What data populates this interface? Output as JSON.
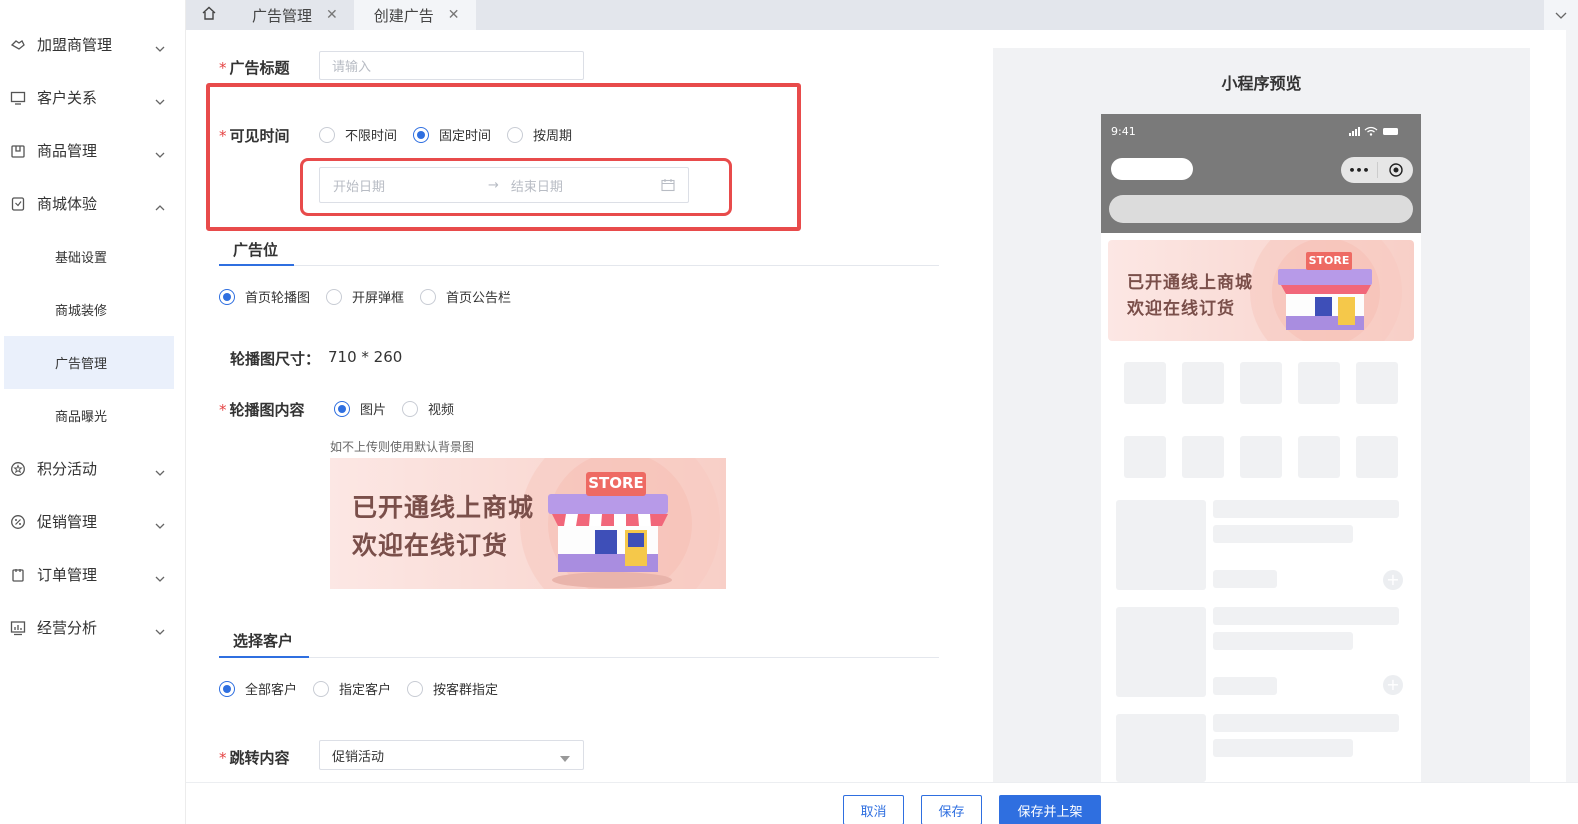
{
  "sidebar": {
    "items": [
      {
        "label": "加盟商管理",
        "icon": "handshake-icon",
        "expanded": false
      },
      {
        "label": "客户关系",
        "icon": "monitor-icon",
        "expanded": false
      },
      {
        "label": "商品管理",
        "icon": "box-icon",
        "expanded": false
      },
      {
        "label": "商城体验",
        "icon": "clipboard-icon",
        "expanded": true
      },
      {
        "label": "积分活动",
        "icon": "star-badge-icon",
        "expanded": false
      },
      {
        "label": "促销管理",
        "icon": "percent-icon",
        "expanded": false
      },
      {
        "label": "订单管理",
        "icon": "order-icon",
        "expanded": false
      },
      {
        "label": "经营分析",
        "icon": "chart-icon",
        "expanded": false
      }
    ],
    "subitems": [
      "基础设置",
      "商城装修",
      "广告管理",
      "商品曝光"
    ],
    "active_subitem": "广告管理"
  },
  "tabs": [
    {
      "label": "广告管理",
      "close": "✕"
    },
    {
      "label": "创建广告",
      "close": "✕"
    }
  ],
  "form": {
    "title_label": "广告标题",
    "title_placeholder": "请输入",
    "visible_time_label": "可见时间",
    "visible_time_options": [
      "不限时间",
      "固定时间",
      "按周期"
    ],
    "visible_time_selected": "固定时间",
    "start_date_placeholder": "开始日期",
    "date_separator": "→",
    "end_date_placeholder": "结束日期",
    "ad_position_section": "广告位",
    "ad_position_options": [
      "首页轮播图",
      "开屏弹框",
      "首页公告栏"
    ],
    "ad_position_selected": "首页轮播图",
    "carousel_size_label": "轮播图尺寸：",
    "carousel_size_value": "710 * 260",
    "carousel_content_label": "轮播图内容",
    "carousel_content_options": [
      "图片",
      "视频"
    ],
    "carousel_content_selected": "图片",
    "upload_hint": "如不上传则使用默认背景图",
    "banner_line1": "已开通线上商城",
    "banner_line2": "欢迎在线订货",
    "banner_store_sign": "STORE",
    "customer_section": "选择客户",
    "customer_options": [
      "全部客户",
      "指定客户",
      "按客群指定"
    ],
    "customer_selected": "全部客户",
    "jump_label": "跳转内容",
    "jump_value": "促销活动"
  },
  "preview": {
    "title": "小程序预览",
    "status_time": "9:41",
    "capsule_more": "•••"
  },
  "buttons": {
    "cancel": "取消",
    "save": "保存",
    "save_publish": "保存并上架"
  },
  "colors": {
    "primary": "#2f6fe0",
    "highlight": "#e84b4b",
    "required": "#e54545"
  }
}
